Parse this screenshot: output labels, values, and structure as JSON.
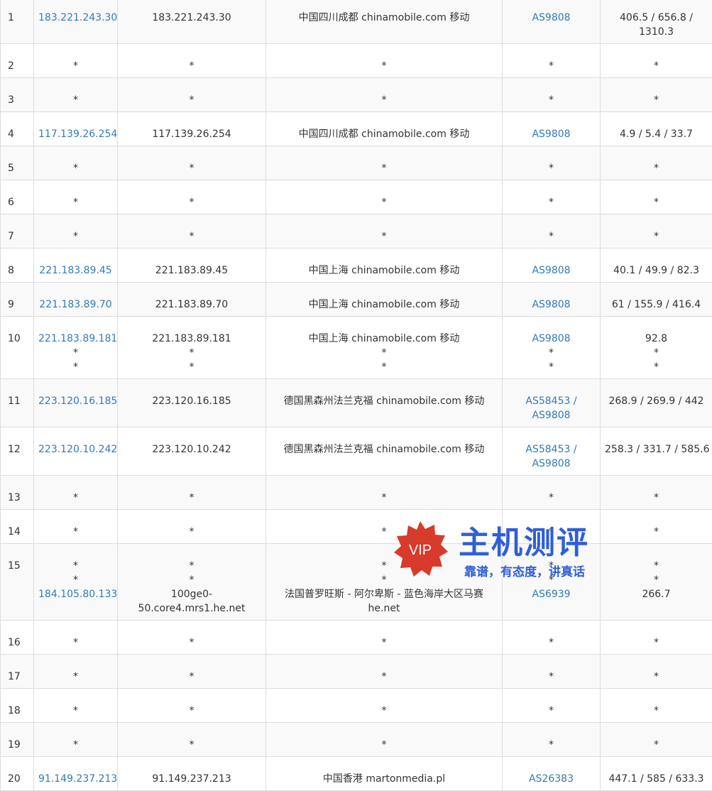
{
  "rows": [
    {
      "hop": "1",
      "ip": [
        "183.221.243.30"
      ],
      "host": [
        "183.221.243.30"
      ],
      "location": [
        "中国四川成都 chinamobile.com 移动"
      ],
      "asn": [
        "AS9808"
      ],
      "rtt": [
        "406.5 / 656.8 /",
        "1310.3"
      ]
    },
    {
      "hop": "2",
      "ip": [
        "*"
      ],
      "host": [
        "*"
      ],
      "location": [
        "*"
      ],
      "asn": [
        "*"
      ],
      "rtt": [
        "*"
      ]
    },
    {
      "hop": "3",
      "ip": [
        "*"
      ],
      "host": [
        "*"
      ],
      "location": [
        "*"
      ],
      "asn": [
        "*"
      ],
      "rtt": [
        "*"
      ]
    },
    {
      "hop": "4",
      "ip": [
        "117.139.26.254"
      ],
      "host": [
        "117.139.26.254"
      ],
      "location": [
        "中国四川成都 chinamobile.com 移动"
      ],
      "asn": [
        "AS9808"
      ],
      "rtt": [
        "4.9 / 5.4 / 33.7"
      ]
    },
    {
      "hop": "5",
      "ip": [
        "*"
      ],
      "host": [
        "*"
      ],
      "location": [
        "*"
      ],
      "asn": [
        "*"
      ],
      "rtt": [
        "*"
      ]
    },
    {
      "hop": "6",
      "ip": [
        "*"
      ],
      "host": [
        "*"
      ],
      "location": [
        "*"
      ],
      "asn": [
        "*"
      ],
      "rtt": [
        "*"
      ]
    },
    {
      "hop": "7",
      "ip": [
        "*"
      ],
      "host": [
        "*"
      ],
      "location": [
        "*"
      ],
      "asn": [
        "*"
      ],
      "rtt": [
        "*"
      ]
    },
    {
      "hop": "8",
      "ip": [
        "221.183.89.45"
      ],
      "host": [
        "221.183.89.45"
      ],
      "location": [
        "中国上海 chinamobile.com 移动"
      ],
      "asn": [
        "AS9808"
      ],
      "rtt": [
        "40.1 / 49.9 / 82.3"
      ]
    },
    {
      "hop": "9",
      "ip": [
        "221.183.89.70"
      ],
      "host": [
        "221.183.89.70"
      ],
      "location": [
        "中国上海 chinamobile.com 移动"
      ],
      "asn": [
        "AS9808"
      ],
      "rtt": [
        "61 / 155.9 / 416.4"
      ]
    },
    {
      "hop": "10",
      "ip": [
        "221.183.89.181",
        "*",
        "*"
      ],
      "host": [
        "221.183.89.181",
        "*",
        "*"
      ],
      "location": [
        "中国上海 chinamobile.com 移动",
        "*",
        "*"
      ],
      "asn": [
        "AS9808",
        "*",
        "*"
      ],
      "rtt": [
        "92.8",
        "*",
        "*"
      ]
    },
    {
      "hop": "11",
      "ip": [
        "223.120.16.185"
      ],
      "host": [
        "223.120.16.185"
      ],
      "location": [
        "德国黑森州法兰克福 chinamobile.com 移动"
      ],
      "asn": [
        "AS58453 /",
        "AS9808"
      ],
      "rtt": [
        "268.9 / 269.9 / 442"
      ]
    },
    {
      "hop": "12",
      "ip": [
        "223.120.10.242"
      ],
      "host": [
        "223.120.10.242"
      ],
      "location": [
        "德国黑森州法兰克福 chinamobile.com 移动"
      ],
      "asn": [
        "AS58453 /",
        "AS9808"
      ],
      "rtt": [
        "258.3 / 331.7 / 585.6"
      ]
    },
    {
      "hop": "13",
      "ip": [
        "*"
      ],
      "host": [
        "*"
      ],
      "location": [
        "*"
      ],
      "asn": [
        "*"
      ],
      "rtt": [
        "*"
      ]
    },
    {
      "hop": "14",
      "ip": [
        "*"
      ],
      "host": [
        "*"
      ],
      "location": [
        "*"
      ],
      "asn": [
        "*"
      ],
      "rtt": [
        "*"
      ]
    },
    {
      "hop": "15",
      "ip": [
        "*",
        "*",
        "184.105.80.133"
      ],
      "host": [
        "*",
        "*",
        "100ge0-",
        "50.core4.mrs1.he.net"
      ],
      "location": [
        "*",
        "*",
        "法国普罗旺斯 - 阿尔卑斯 - 蓝色海岸大区马赛",
        "he.net"
      ],
      "asn": [
        "*",
        "*",
        "AS6939"
      ],
      "rtt": [
        "*",
        "*",
        "266.7"
      ]
    },
    {
      "hop": "16",
      "ip": [
        "*"
      ],
      "host": [
        "*"
      ],
      "location": [
        "*"
      ],
      "asn": [
        "*"
      ],
      "rtt": [
        "*"
      ]
    },
    {
      "hop": "17",
      "ip": [
        "*"
      ],
      "host": [
        "*"
      ],
      "location": [
        "*"
      ],
      "asn": [
        "*"
      ],
      "rtt": [
        "*"
      ]
    },
    {
      "hop": "18",
      "ip": [
        "*"
      ],
      "host": [
        "*"
      ],
      "location": [
        "*"
      ],
      "asn": [
        "*"
      ],
      "rtt": [
        "*"
      ]
    },
    {
      "hop": "19",
      "ip": [
        "*"
      ],
      "host": [
        "*"
      ],
      "location": [
        "*"
      ],
      "asn": [
        "*"
      ],
      "rtt": [
        "*"
      ]
    },
    {
      "hop": "20",
      "ip": [
        "91.149.237.213"
      ],
      "host": [
        "91.149.237.213"
      ],
      "location": [
        "中国香港 martonmedia.pl"
      ],
      "asn": [
        "AS26383"
      ],
      "rtt": [
        "447.1 / 585 / 633.3"
      ]
    }
  ],
  "watermark": {
    "badge_text": "VIP",
    "title": "主机测评",
    "subtitle": "靠谱，有态度，讲真话"
  },
  "colors": {
    "link": "#337ab7",
    "stripe": "#f9f9f9",
    "border": "#dddddd",
    "watermark_blue": "#2f5fd6",
    "badge_red": "#d83a2b"
  },
  "icons": {
    "badge": "vip-badge-icon"
  }
}
